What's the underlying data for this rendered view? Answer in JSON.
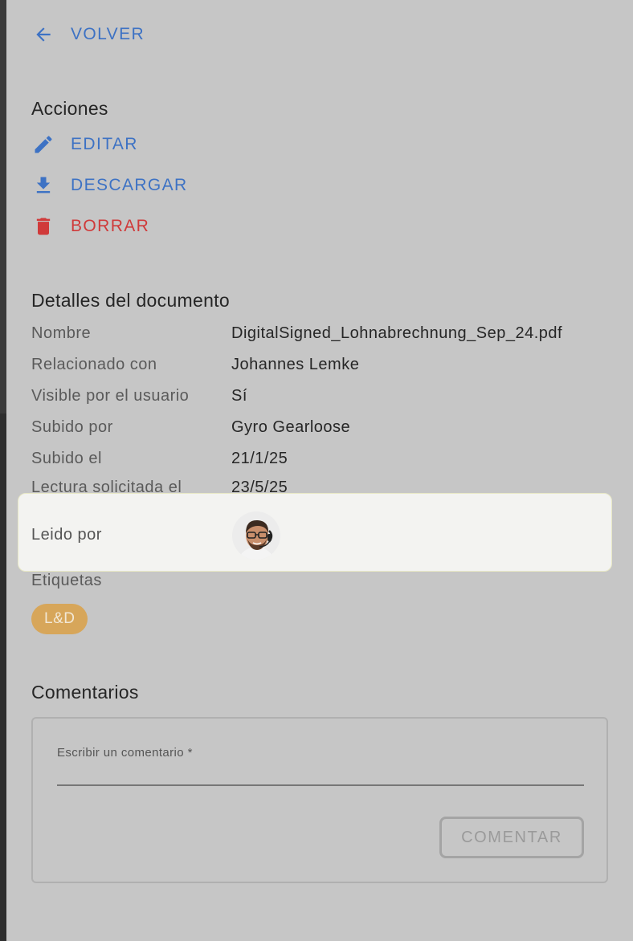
{
  "nav": {
    "back_label": "VOLVER"
  },
  "actions": {
    "title": "Acciones",
    "edit_label": "EDITAR",
    "download_label": "DESCARGAR",
    "delete_label": "BORRAR"
  },
  "details": {
    "title": "Detalles del documento",
    "rows": [
      {
        "label": "Nombre",
        "value": "DigitalSigned_Lohnabrechnung_Sep_24.pdf"
      },
      {
        "label": "Relacionado con",
        "value": "Johannes Lemke"
      },
      {
        "label": "Visible por el usuario",
        "value": "Sí"
      },
      {
        "label": "Subido por",
        "value": "Gyro Gearloose"
      },
      {
        "label": "Subido el",
        "value": "21/1/25"
      },
      {
        "label": "Lectura solicitada el",
        "value": "23/5/25"
      }
    ],
    "read_by_label": "Leido por",
    "tags_label": "Etiquetas",
    "tags": [
      "L&D"
    ]
  },
  "comments": {
    "title": "Comentarios",
    "input_placeholder": "Escribir un comentario *",
    "submit_label": "COMENTAR"
  },
  "colors": {
    "link": "#3d72c4",
    "danger": "#d03a3a",
    "tag_bg": "#d7a65a",
    "highlight_bg": "#f3f3f1"
  },
  "icons": {
    "back": "arrow-left-icon",
    "edit": "pencil-icon",
    "download": "download-icon",
    "delete": "trash-icon"
  }
}
